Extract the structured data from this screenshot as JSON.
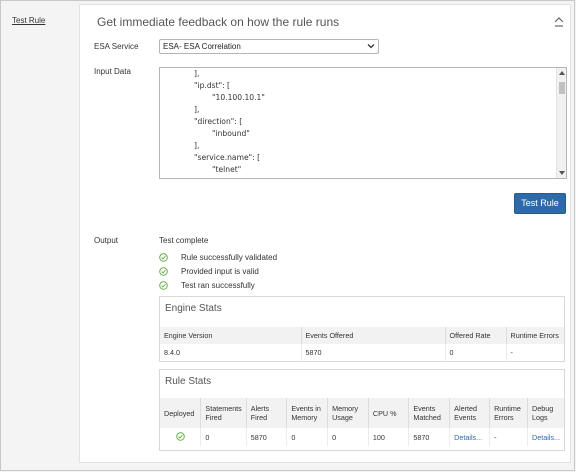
{
  "side_nav": {
    "label": "Test Rule"
  },
  "header": {
    "title": "Get immediate feedback on how the rule runs"
  },
  "esa_service": {
    "label": "ESA Service",
    "selected": "ESA- ESA Correlation"
  },
  "input_data": {
    "label": "Input Data",
    "lines": [
      "],",
      "\"ip.dst\": [",
      "\"10.100.10.1\"",
      "],",
      "\"direction\": [",
      "\"inbound\"",
      "],",
      "\"service.name\": [",
      "\"telnet\"",
      "],"
    ]
  },
  "test_button": {
    "label": "Test Rule"
  },
  "output": {
    "label": "Output",
    "status": "Test complete",
    "checks": [
      "Rule successfully validated",
      "Provided input is valid",
      "Test ran successfully"
    ]
  },
  "engine_stats": {
    "title": "Engine Stats",
    "columns": [
      "Engine Version",
      "Events Offered",
      "Offered Rate",
      "Runtime Errors"
    ],
    "row": [
      "8.4.0",
      "5870",
      "0",
      "-"
    ]
  },
  "rule_stats": {
    "title": "Rule Stats",
    "columns": [
      [
        "Deployed",
        ""
      ],
      [
        "Statements",
        "Fired"
      ],
      [
        "Alerts",
        "Fired"
      ],
      [
        "Events in",
        "Memory"
      ],
      [
        "Memory",
        "Usage"
      ],
      [
        "CPU %",
        ""
      ],
      [
        "Events",
        "Matched"
      ],
      [
        "Alerted",
        "Events"
      ],
      [
        "Runtime",
        "Errors"
      ],
      [
        "Debug",
        "Logs"
      ]
    ],
    "row": [
      "",
      "0",
      "5870",
      "0",
      "0",
      "100",
      "5870",
      "Details...",
      "-",
      "Details..."
    ]
  },
  "colors": {
    "accent": "#2e6aa8",
    "check": "#5aa83a"
  }
}
